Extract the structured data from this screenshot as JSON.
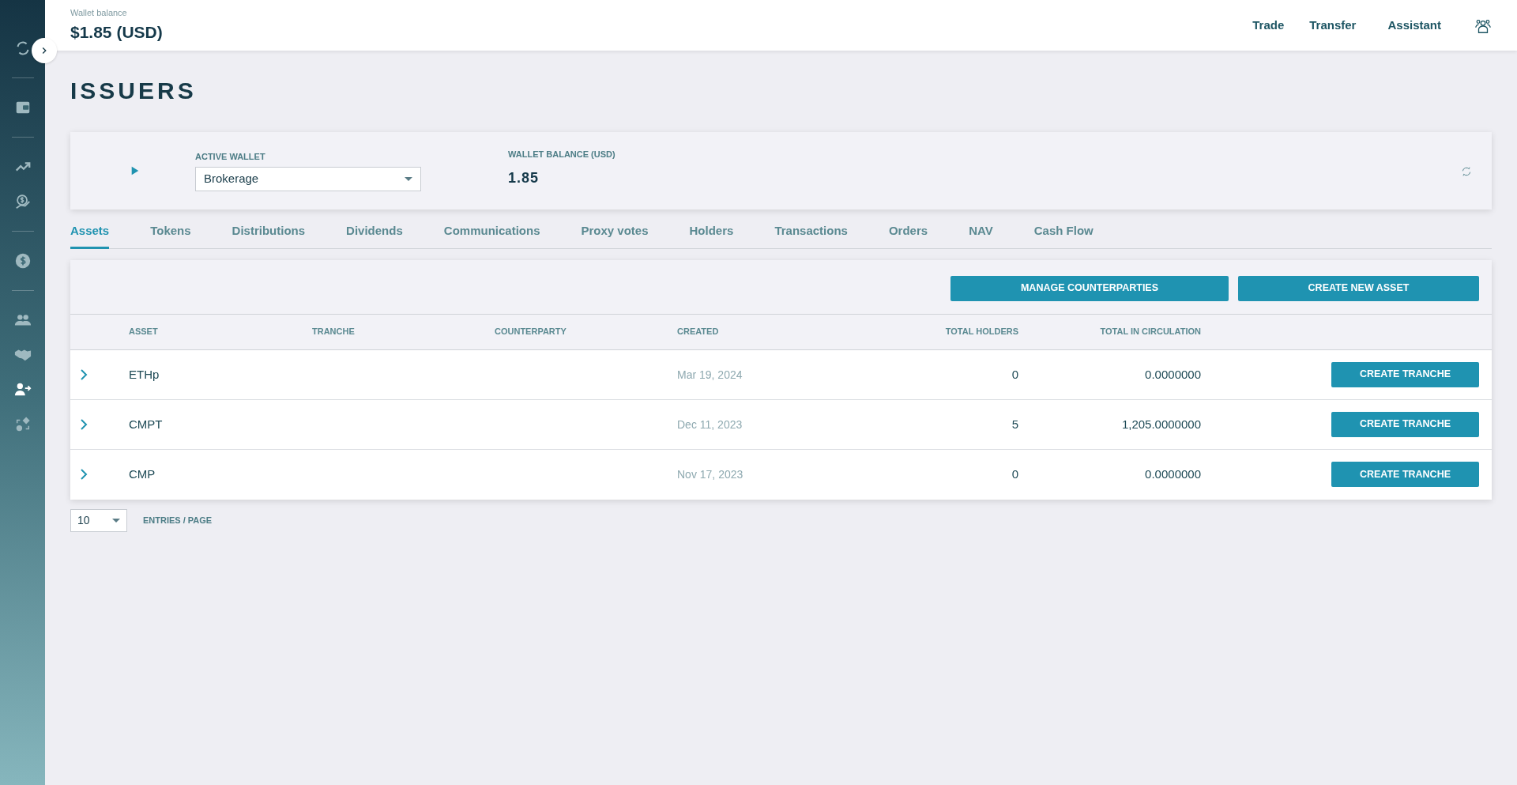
{
  "sidebar": {
    "groups": [
      {
        "items": [
          {
            "selected": false
          }
        ]
      },
      {
        "items": [
          {
            "selected": false
          }
        ]
      },
      {
        "items": [
          {
            "selected": false
          },
          {
            "selected": false
          }
        ]
      },
      {
        "items": [
          {
            "selected": false
          }
        ]
      },
      {
        "items": [
          {
            "selected": false
          },
          {
            "selected": false
          },
          {
            "selected": true
          },
          {
            "selected": false
          }
        ]
      }
    ]
  },
  "header": {
    "balance_label": "Wallet balance",
    "balance": "$1.85 (USD)",
    "nav": [
      "Trade",
      "Transfer",
      "Assistant"
    ]
  },
  "page_title": "ISSUERS",
  "wallet_card": {
    "active_wallet_label": "ACTIVE WALLET",
    "active_wallet": "Brokerage",
    "balance_label": "WALLET BALANCE (USD)",
    "balance": "1.85"
  },
  "tabs": [
    {
      "label": "Assets",
      "selected": true
    },
    {
      "label": "Tokens",
      "selected": false
    },
    {
      "label": "Distributions",
      "selected": false
    },
    {
      "label": "Dividends",
      "selected": false
    },
    {
      "label": "Communications",
      "selected": false
    },
    {
      "label": "Proxy votes",
      "selected": false
    },
    {
      "label": "Holders",
      "selected": false
    },
    {
      "label": "Transactions",
      "selected": false
    },
    {
      "label": "Orders",
      "selected": false
    },
    {
      "label": "NAV",
      "selected": false
    },
    {
      "label": "Cash Flow",
      "selected": false
    }
  ],
  "toolbar": {
    "buttons": [
      "MANAGE COUNTERPARTIES",
      "CREATE NEW ASSET"
    ]
  },
  "table": {
    "columns": [
      "ASSET",
      "TRANCHE",
      "COUNTERPARTY",
      "CREATED",
      "TOTAL HOLDERS",
      "TOTAL IN CIRCULATION"
    ],
    "rows": [
      {
        "asset": "ETHp",
        "created": "Mar 19, 2024",
        "total_holders": "0",
        "total_in_circulation": "0.0000000",
        "action": "CREATE TRANCHE"
      },
      {
        "asset": "CMPT",
        "created": "Dec 11, 2023",
        "total_holders": "5",
        "total_in_circulation": "1,205.0000000",
        "action": "CREATE TRANCHE"
      },
      {
        "asset": "CMP",
        "created": "Nov 17, 2023",
        "total_holders": "0",
        "total_in_circulation": "0.0000000",
        "action": "CREATE TRANCHE"
      }
    ]
  },
  "pagination": {
    "page_size": "10",
    "label": "ENTRIES / PAGE"
  }
}
